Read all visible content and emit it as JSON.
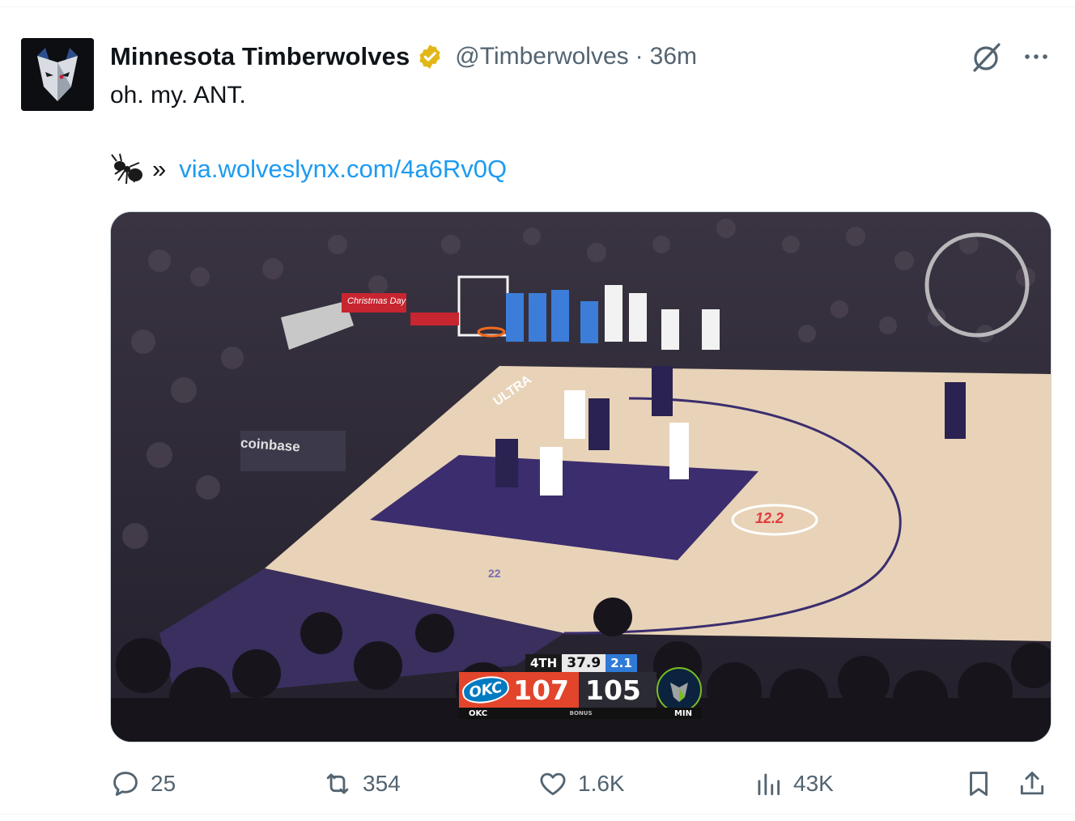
{
  "tweet": {
    "display_name": "Minnesota Timberwolves",
    "handle": "@Timberwolves",
    "separator": "·",
    "time": "36m",
    "text": "oh. my. ANT.",
    "link_prefix": "»",
    "link_text": "via.wolveslynx.com/4a6Rv0Q",
    "verified_badge_color": "#e2b719",
    "link_color": "#1d9bf0"
  },
  "media": {
    "scorebug": {
      "period": "4TH",
      "clock": "37.9",
      "shot_clock": "2.1",
      "home_logo_text": "OKC",
      "home_score": "107",
      "away_score": "105",
      "home_abbr": "OKC",
      "bonus_label": "BONUS",
      "away_abbr": "MIN"
    },
    "court_clock_display": "12.2",
    "sponsor_text": "coinbase",
    "baseline_text": "ULTRA",
    "banner_text": "Christmas Day",
    "player_number": "22"
  },
  "actions": {
    "replies": "25",
    "reposts": "354",
    "likes": "1.6K",
    "views": "43K"
  },
  "icons": [
    "verified-badge-icon",
    "grok-icon",
    "more-icon",
    "ant-emoji-icon",
    "reply-icon",
    "repost-icon",
    "like-icon",
    "views-icon",
    "bookmark-icon",
    "share-icon"
  ]
}
